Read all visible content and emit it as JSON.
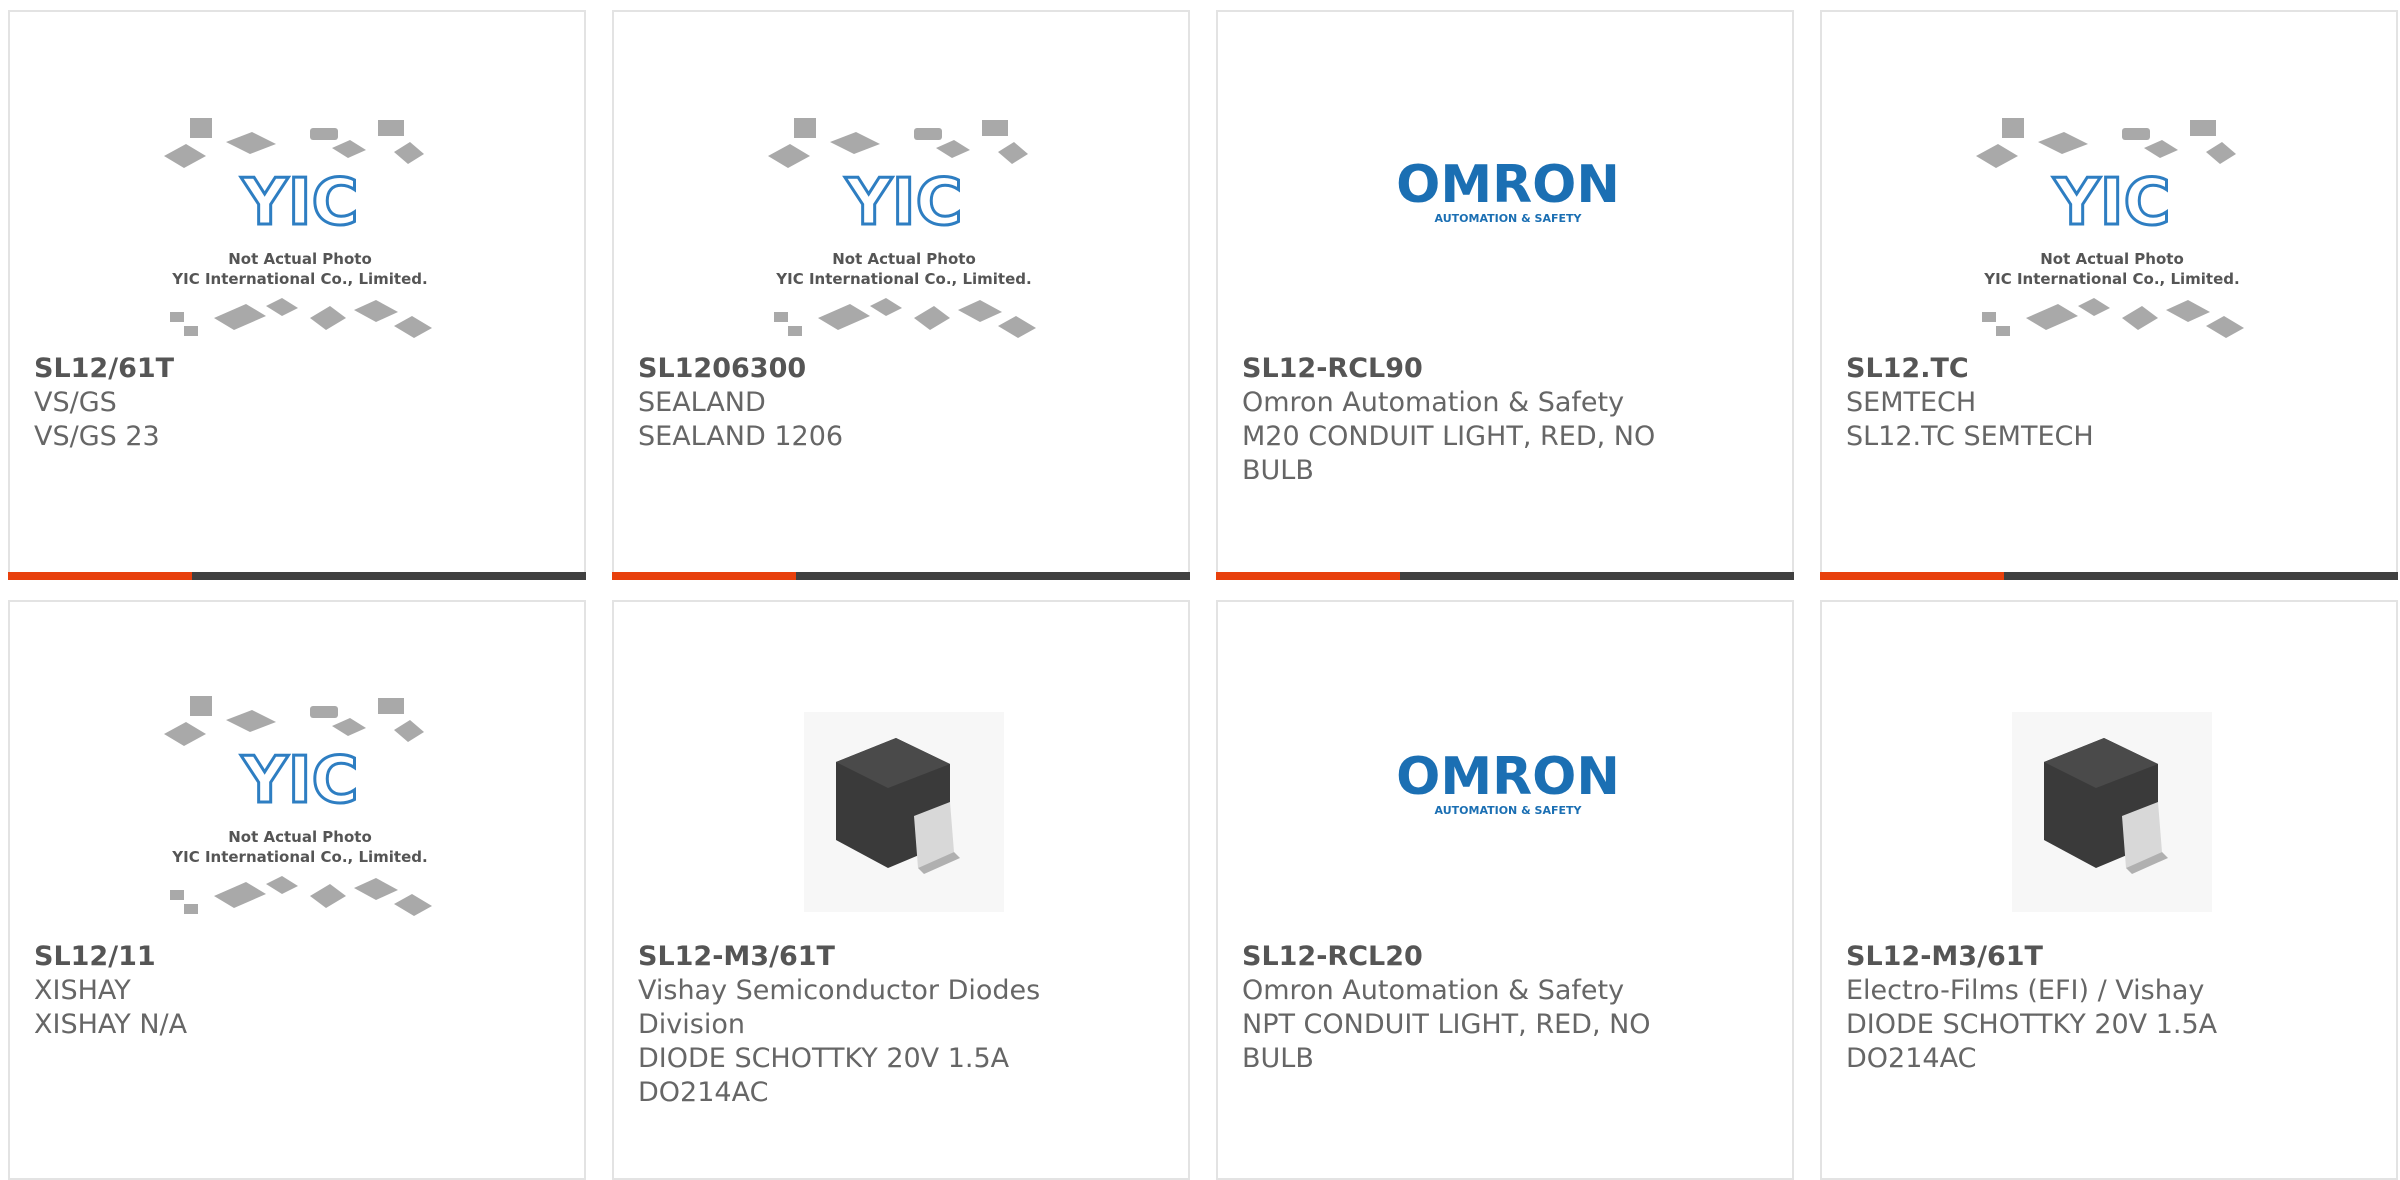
{
  "colors": {
    "accent": "#e8400c",
    "bar_dark": "#404040",
    "card_border": "#e3e3e3",
    "text": "#666666",
    "omron_blue": "#1b6fb3"
  },
  "placeholder": {
    "brand": "YIC",
    "line1": "Not Actual Photo",
    "line2": "YIC International Co., Limited."
  },
  "omron": {
    "brand": "OMRON",
    "tagline": "AUTOMATION & SAFETY"
  },
  "products": [
    {
      "part": "SL12/61T",
      "manufacturer": "VS/GS",
      "desc1": "VS/GS 23",
      "desc2": "",
      "desc3": ""
    },
    {
      "part": "SL1206300",
      "manufacturer": "SEALAND",
      "desc1": "SEALAND 1206",
      "desc2": "",
      "desc3": ""
    },
    {
      "part": "SL12-RCL90",
      "manufacturer": "Omron Automation & Safety",
      "desc1": "M20 CONDUIT LIGHT, RED, NO",
      "desc2": "BULB",
      "desc3": ""
    },
    {
      "part": "SL12.TC",
      "manufacturer": "SEMTECH",
      "desc1": "SL12.TC SEMTECH",
      "desc2": "",
      "desc3": ""
    },
    {
      "part": "SL12/11",
      "manufacturer": "XISHAY",
      "desc1": "XISHAY N/A",
      "desc2": "",
      "desc3": ""
    },
    {
      "part": "SL12-M3/61T",
      "manufacturer": "Vishay Semiconductor Diodes",
      "desc1": "Division",
      "desc2": "DIODE SCHOTTKY 20V 1.5A",
      "desc3": "DO214AC"
    },
    {
      "part": "SL12-RCL20",
      "manufacturer": "Omron Automation & Safety",
      "desc1": "NPT CONDUIT LIGHT, RED, NO",
      "desc2": "BULB",
      "desc3": ""
    },
    {
      "part": "SL12-M3/61T",
      "manufacturer": "Electro-Films (EFI) / Vishay",
      "desc1": "DIODE SCHOTTKY 20V 1.5A",
      "desc2": "DO214AC",
      "desc3": ""
    }
  ]
}
